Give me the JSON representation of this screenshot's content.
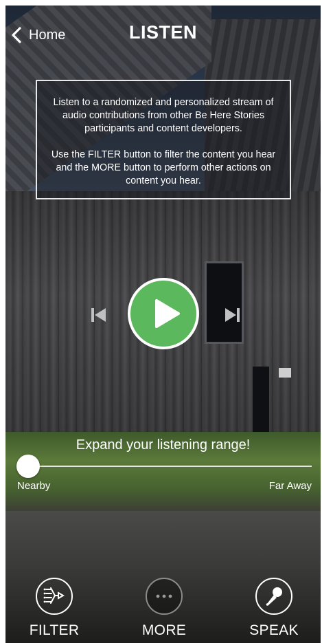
{
  "header": {
    "back_label": "Home",
    "title": "LISTEN"
  },
  "info": {
    "paragraph1": "Listen to a randomized and personalized stream of audio contributions from other Be Here Stories participants and content developers.",
    "paragraph2": "Use the FILTER button to filter the content you hear and the MORE button to perform other actions on content you hear."
  },
  "player": {
    "state": "paused",
    "play_button_color": "#5cb85c",
    "prev_icon": "skip-back-icon",
    "next_icon": "skip-forward-icon"
  },
  "range": {
    "caption": "Expand your listening range!",
    "min_label": "Nearby",
    "max_label": "Far Away",
    "value": 0
  },
  "toolbar": {
    "filter_label": "FILTER",
    "more_label": "MORE",
    "speak_label": "SPEAK"
  }
}
